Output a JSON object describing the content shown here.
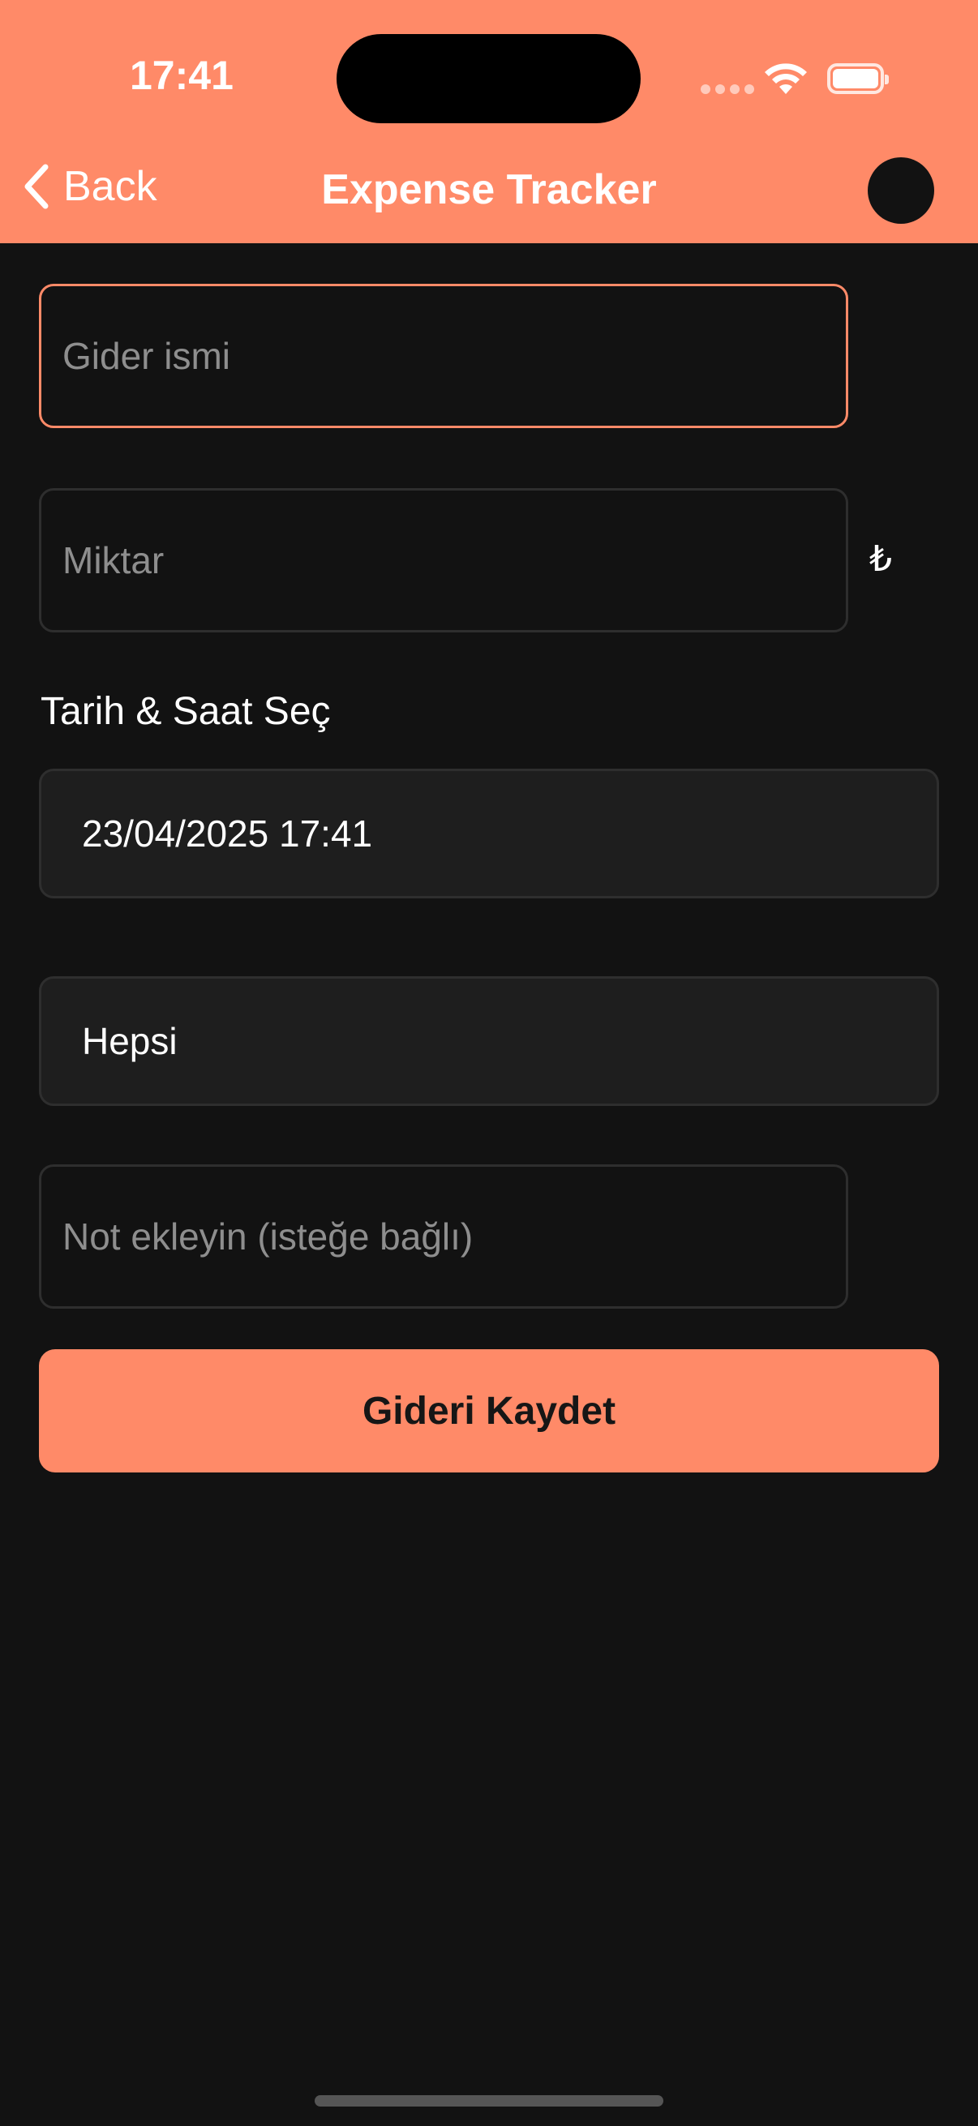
{
  "status_bar": {
    "time": "17:41"
  },
  "nav": {
    "back_label": "Back",
    "title": "Expense Tracker"
  },
  "form": {
    "name_placeholder": "Gider ismi",
    "amount_placeholder": "Miktar",
    "currency_symbol": "₺",
    "datetime_label": "Tarih & Saat Seç",
    "datetime_value": "23/04/2025 17:41",
    "category_value": "Hepsi",
    "note_placeholder": "Not ekleyin (isteğe bağlı)",
    "save_label": "Gideri Kaydet"
  },
  "colors": {
    "accent": "#FF8A68",
    "background": "#121212",
    "field_background": "#1E1E1E"
  },
  "icons": {
    "back": "chevron-left-icon",
    "wifi": "wifi-icon",
    "battery": "battery-icon"
  }
}
